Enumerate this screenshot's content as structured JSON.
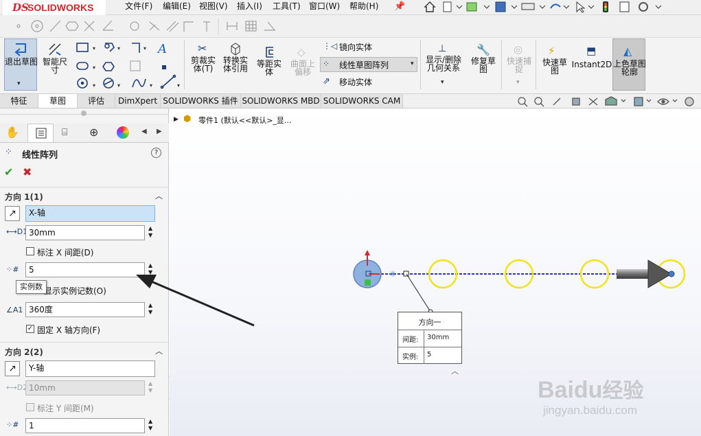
{
  "app": {
    "logo_ds": "DS",
    "logo_name": "SOLIDWORKS"
  },
  "menu": [
    {
      "label": "文件(F)"
    },
    {
      "label": "编辑(E)"
    },
    {
      "label": "视图(V)"
    },
    {
      "label": "插入(I)"
    },
    {
      "label": "工具(T)"
    },
    {
      "label": "窗口(W)"
    },
    {
      "label": "帮助(H)"
    }
  ],
  "ribbon": {
    "exit_sketch": "退出草图",
    "smart_dim": "智能尺寸",
    "trim": "剪裁实体(T)",
    "convert": "转换实体引用",
    "offset": "等距实体",
    "surface_offset": "曲面上偏移",
    "mirror": "镜向实体",
    "linear_pattern": "线性草图阵列",
    "move": "移动实体",
    "show_delete": "显示/删除几何关系",
    "repair": "修复草图",
    "quick_snap": "快速捕捉",
    "rapid_sketch": "快速草图",
    "instant2d": "Instant2D",
    "shaded_sketch": "上色草图轮廓"
  },
  "tabs": [
    "特征",
    "草图",
    "评估",
    "DimXpert",
    "SOLIDWORKS 插件",
    "SOLIDWORKS MBD",
    "SOLIDWORKS CAM"
  ],
  "tree": {
    "part": "零件1 (默认<<默认>_显..."
  },
  "panel": {
    "title": "线性阵列",
    "dir1": {
      "heading": "方向 1(1)",
      "axis": "X-轴",
      "spacing": "30mm",
      "dim_spacing": "标注 X 间距(D)",
      "instances": "5",
      "tooltip": "实例数",
      "show_count": "显示实例记数(O)",
      "angle": "360度",
      "fix_dir": "固定 X 轴方向(F)"
    },
    "dir2": {
      "heading": "方向 2(2)",
      "axis": "Y-轴",
      "spacing": "10mm",
      "dim_spacing": "标注 Y 间距(M)",
      "instances": "1"
    }
  },
  "callout": {
    "title": "方向一",
    "row1_label": "间距:",
    "row1_value": "30mm",
    "row2_label": "实例:",
    "row2_value": "5"
  },
  "watermark": {
    "brand": "Baidu",
    "brand_cn": "经验",
    "url": "jingyan.baidu.com"
  },
  "colors": {
    "accent": "#1f4fb4",
    "logo_red": "#d4262c",
    "yellow": "#f2e21a",
    "line_blue": "#2d2fc8"
  }
}
